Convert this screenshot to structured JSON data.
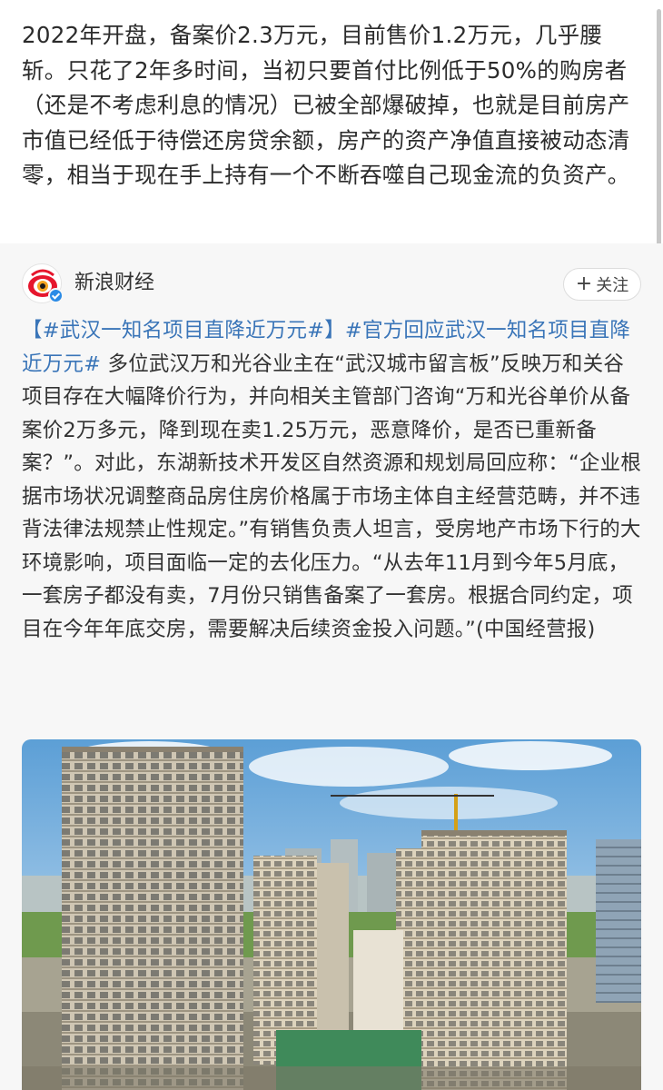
{
  "post": {
    "text": "2022年开盘，备案价2.3万元，目前售价1.2万元，几乎腰斩。只花了2年多时间，当初只要首付比例低于50%的购房者（还是不考虑利息的情况）已被全部爆破掉，也就是目前房产市值已经低于待偿还房贷余额，房产的资产净值直接被动态清零，相当于现在手上持有一个不断吞噬自己现金流的负资产。"
  },
  "retweet": {
    "author": "新浪财经",
    "follow_label": "关注",
    "tag1": "【#武汉一知名项目直降近万元#】",
    "tag2": "#官方回应武汉一知名项目直降近万元#",
    "body": " 多位武汉万和光谷业主在“武汉城市留言板”反映万和关谷项目存在大幅降价行为，并向相关主管部门咨询“万和光谷单价从备案价2万多元，降到现在卖1.25万元，恶意降价，是否已重新备案？”。对此，东湖新技术开发区自然资源和规划局回应称：“企业根据市场状况调整商品房住房价格属于市场主体自主经营范畴，并不违背法律法规禁止性规定。”有销售负责人坦言，受房地产市场下行的大环境影响，项目面临一定的去化压力。“从去年11月到今年5月底，一套房子都没有卖，7月份只销售备案了一套房。根据合同约定，项目在今年年底交房，需要解决后续资金投入问题。”(中国经营报)"
  },
  "colors": {
    "tag": "#3a75b8",
    "retweet_bg": "#f7f7f7",
    "verified": "#2b8be6"
  }
}
